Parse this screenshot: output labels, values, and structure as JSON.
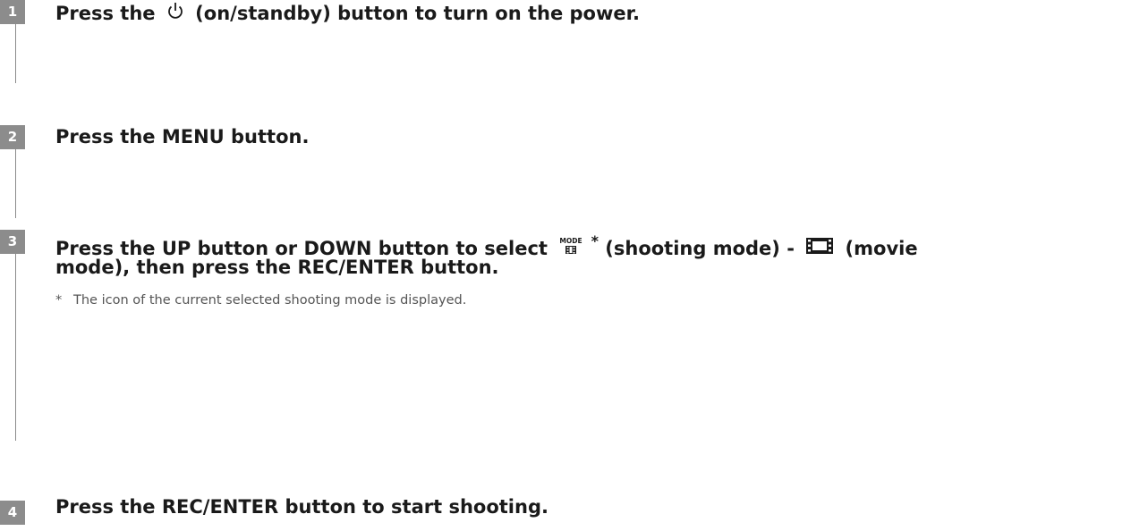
{
  "steps": [
    {
      "number": "1",
      "title_before": "Press the",
      "icon": "power-standby-icon",
      "title_after": "(on/standby) button to turn on the power."
    },
    {
      "number": "2",
      "title": "Press the MENU button."
    },
    {
      "number": "3",
      "title_part1": "Press the UP button or DOWN button to select",
      "mode_icon": "mode-shooting-icon",
      "asterisk": "*",
      "title_part2": "(shooting mode) -",
      "movie_icon": "movie-mode-icon",
      "title_part3": "(movie",
      "title_line2": "mode), then press the REC/ENTER button.",
      "note_marker": "*",
      "note": "The icon of the current selected shooting mode is displayed."
    },
    {
      "number": "4",
      "title": "Press the REC/ENTER button to start shooting."
    }
  ],
  "colors": {
    "badge": "#8c8c8c",
    "text": "#1a1a1a",
    "note_text": "#555555"
  }
}
